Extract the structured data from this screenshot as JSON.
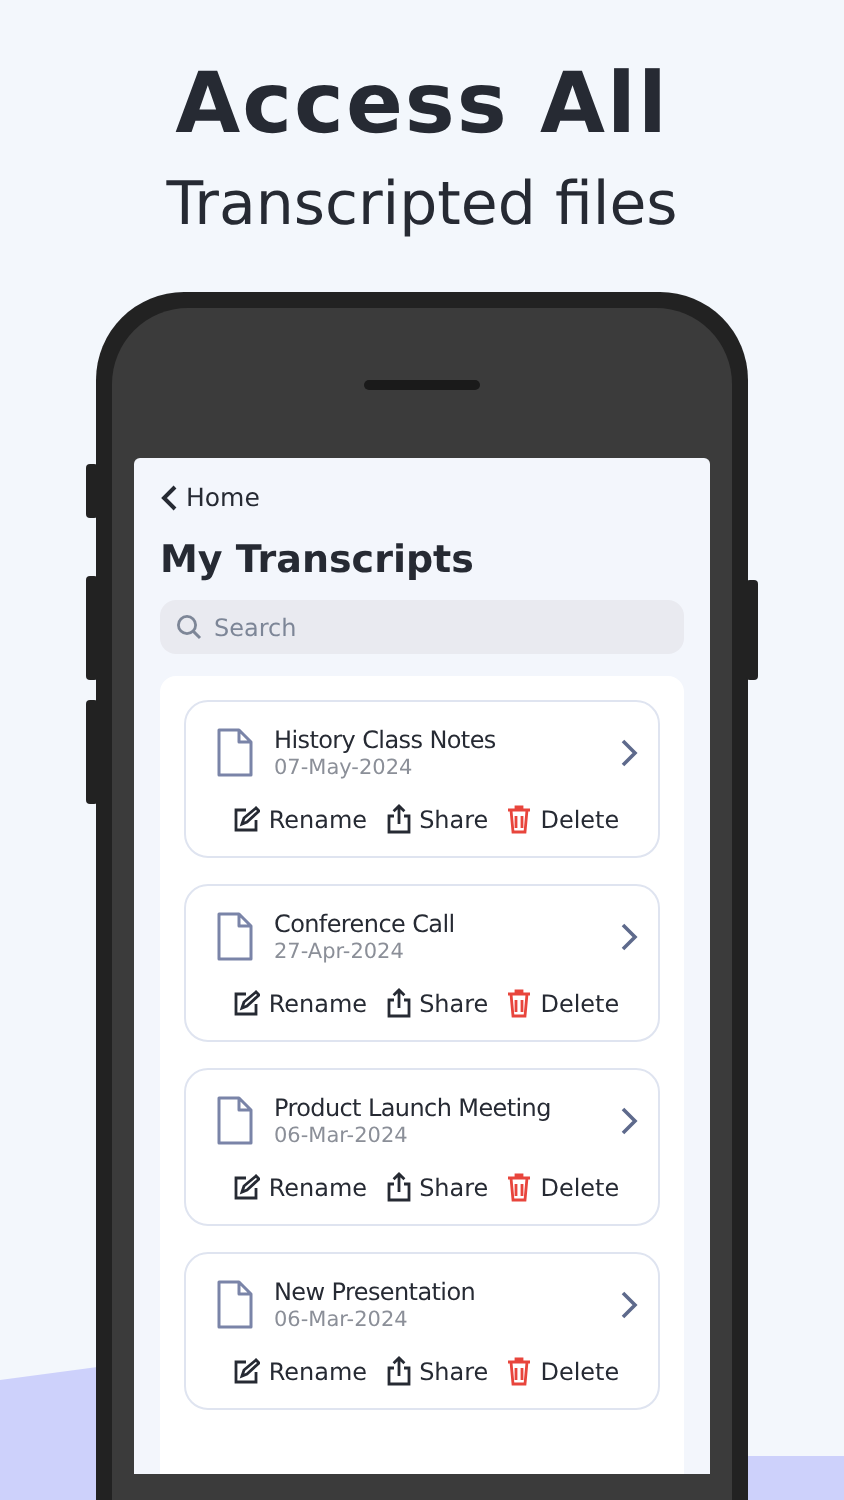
{
  "headline": "Access All",
  "subheadline": "Transcripted files",
  "screen": {
    "back_label": "Home",
    "title": "My Transcripts",
    "search": {
      "placeholder": "Search"
    },
    "transcripts": [
      {
        "name": "History Class Notes",
        "date": "07-May-2024",
        "actions": [
          "Rename",
          "Share",
          "Delete"
        ]
      },
      {
        "name": "Conference Call",
        "date": "27-Apr-2024",
        "actions": [
          "Rename",
          "Share",
          "Delete"
        ]
      },
      {
        "name": "Product Launch Meeting",
        "date": "06-Mar-2024",
        "actions": [
          "Rename",
          "Share",
          "Delete"
        ]
      },
      {
        "name": "New Presentation",
        "date": "06-Mar-2024",
        "actions": [
          "Rename",
          "Share",
          "Delete"
        ]
      }
    ]
  }
}
